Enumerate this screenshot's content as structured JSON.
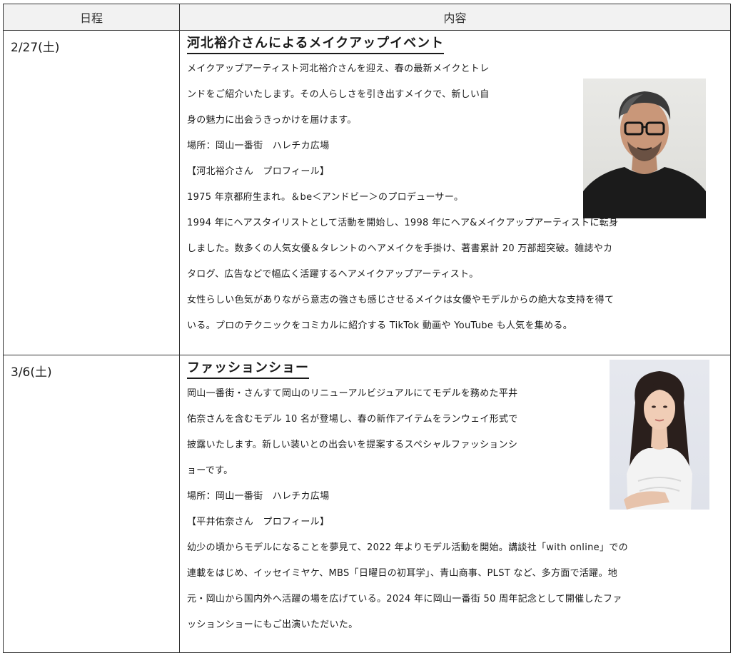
{
  "table": {
    "header_date": "日程",
    "header_content": "内容"
  },
  "events": [
    {
      "date": "2/27(土)",
      "title": "河北裕介さんによるメイクアップイベント",
      "lines": [
        "メイクアップアーティスト河北裕介さんを迎え、春の最新メイクとトレ",
        "ンドをご紹介いたします。その人らしさを引き出すメイクで、新しい自",
        "身の魅力に出会うきっかけを届けます。",
        "場所：岡山一番街　ハレチカ広場",
        "【河北裕介さん　プロフィール】",
        "1975 年京都府生まれ。＆be＜アンドビー＞のプロデューサー。",
        "1994 年にヘアスタイリストとして活動を開始し、1998 年にヘア&メイクアップアーティストに転身",
        "しました。数多くの人気女優＆タレントのヘアメイクを手掛け、著書累計 20 万部超突破。雑誌やカ",
        "タログ、広告などで幅広く活躍するヘアメイクアップアーティスト。",
        "女性らしい色気がありながら意志の強さも感じさせるメイクは女優やモデルからの絶大な支持を得て",
        "いる。プロのテクニックをコミカルに紹介する TikTok 動画や YouTube も人気を集める。"
      ]
    },
    {
      "date": "3/6(土)",
      "title": "ファッションショー",
      "lines": [
        "岡山一番街・さんすて岡山のリニューアルビジュアルにてモデルを務めた平井",
        "佑奈さんを含むモデル 10 名が登場し、春の新作アイテムをランウェイ形式で",
        "披露いたします。新しい装いとの出会いを提案するスペシャルファッションシ",
        "ョーです。",
        "場所：岡山一番街　ハレチカ広場",
        "【平井佑奈さん　プロフィール】",
        "幼少の頃からモデルになることを夢見て、2022 年よりモデル活動を開始。講談社「with online」での",
        "連載をはじめ、イッセイミヤケ、MBS「日曜日の初耳学」、青山商事、PLST など、多方面で活躍。地",
        "元・岡山から国内外へ活躍の場を広げている。2024 年に岡山一番街 50 周年記念として開催したファ",
        "ッションショーにもご出演いただいた。"
      ]
    }
  ]
}
